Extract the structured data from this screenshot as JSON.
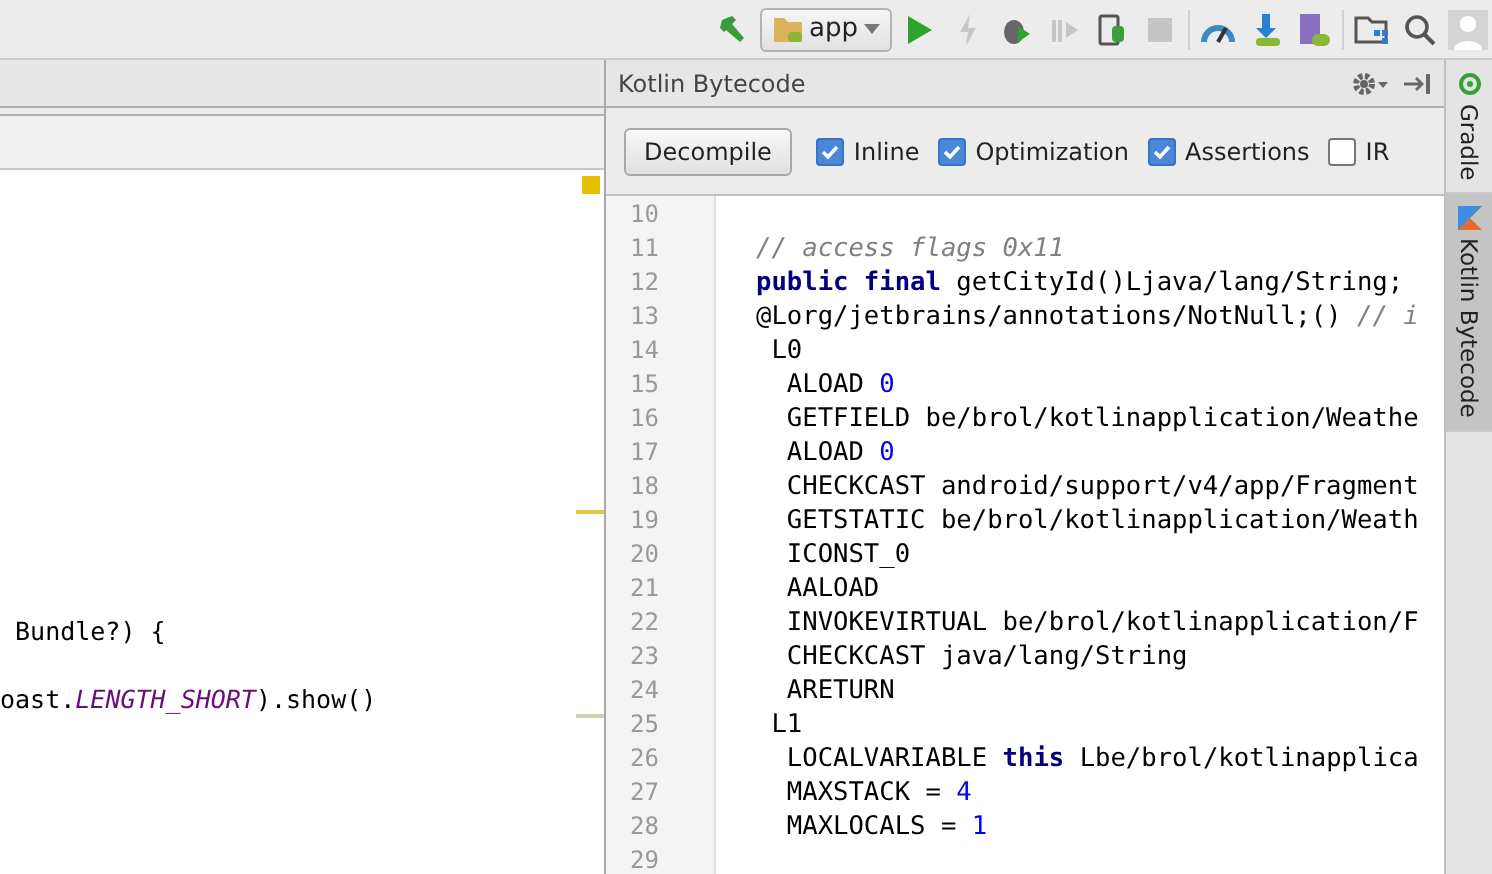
{
  "toolbar": {
    "run_config": "app",
    "buttons": [
      {
        "kind": "build",
        "disabled": false
      },
      {
        "kind": "config"
      },
      {
        "kind": "run",
        "disabled": false
      },
      {
        "kind": "apply",
        "disabled": true
      },
      {
        "kind": "debug",
        "disabled": false
      },
      {
        "kind": "attach",
        "disabled": true
      },
      {
        "kind": "device",
        "disabled": false
      },
      {
        "kind": "stop",
        "disabled": true
      },
      {
        "kind": "profiler",
        "disabled": false
      },
      {
        "kind": "sdk",
        "disabled": false
      },
      {
        "kind": "avd",
        "disabled": false
      },
      {
        "kind": "structure",
        "disabled": false
      },
      {
        "kind": "search",
        "disabled": false
      },
      {
        "kind": "avatar",
        "disabled": false
      }
    ]
  },
  "editor": {
    "lines": [
      [
        {
          "text": " Bundle?) {",
          "kind": "plain"
        }
      ],
      [
        {
          "text": "oast.",
          "kind": "plain"
        },
        {
          "text": "LENGTH_SHORT",
          "kind": "constant"
        },
        {
          "text": ").show()",
          "kind": "plain"
        }
      ]
    ]
  },
  "bytecode_panel": {
    "title": "Kotlin Bytecode",
    "decompile": "Decompile",
    "options": [
      {
        "label": "Inline",
        "checked": true
      },
      {
        "label": "Optimization",
        "checked": true
      },
      {
        "label": "Assertions",
        "checked": true
      },
      {
        "label": "IR",
        "checked": false
      }
    ],
    "lines": [
      {
        "number": "10"
      },
      {
        "number": "11",
        "segments": [
          {
            "text": "// access flags 0x11",
            "kind": "comment"
          }
        ]
      },
      {
        "number": "12",
        "segments": [
          {
            "text": "public final",
            "kind": "keyword"
          },
          {
            "text": " getCityId()Ljava/lang/String;",
            "kind": "plain"
          }
        ]
      },
      {
        "number": "13",
        "segments": [
          {
            "text": "@Lorg/jetbrains/annotations/NotNull;() ",
            "kind": "plain"
          },
          {
            "text": "// i",
            "kind": "comment"
          }
        ]
      },
      {
        "number": "14",
        "segments": [
          {
            "text": " L0",
            "kind": "plain"
          }
        ]
      },
      {
        "number": "15",
        "segments": [
          {
            "text": "  ALOAD ",
            "kind": "plain"
          },
          {
            "text": "0",
            "kind": "number"
          }
        ]
      },
      {
        "number": "16",
        "segments": [
          {
            "text": "  GETFIELD be/brol/kotlinapplication/Weathe",
            "kind": "plain"
          }
        ]
      },
      {
        "number": "17",
        "segments": [
          {
            "text": "  ALOAD ",
            "kind": "plain"
          },
          {
            "text": "0",
            "kind": "number"
          }
        ]
      },
      {
        "number": "18",
        "segments": [
          {
            "text": "  CHECKCAST android/support/v4/app/Fragment",
            "kind": "plain"
          }
        ]
      },
      {
        "number": "19",
        "segments": [
          {
            "text": "  GETSTATIC be/brol/kotlinapplication/Weath",
            "kind": "plain"
          }
        ]
      },
      {
        "number": "20",
        "segments": [
          {
            "text": "  ICONST_0",
            "kind": "plain"
          }
        ]
      },
      {
        "number": "21",
        "segments": [
          {
            "text": "  AALOAD",
            "kind": "plain"
          }
        ]
      },
      {
        "number": "22",
        "segments": [
          {
            "text": "  INVOKEVIRTUAL be/brol/kotlinapplication/F",
            "kind": "plain"
          }
        ]
      },
      {
        "number": "23",
        "segments": [
          {
            "text": "  CHECKCAST java/lang/String",
            "kind": "plain"
          }
        ]
      },
      {
        "number": "24",
        "segments": [
          {
            "text": "  ARETURN",
            "kind": "plain"
          }
        ]
      },
      {
        "number": "25",
        "segments": [
          {
            "text": " L1",
            "kind": "plain"
          }
        ]
      },
      {
        "number": "26",
        "segments": [
          {
            "text": "  LOCALVARIABLE ",
            "kind": "plain"
          },
          {
            "text": "this",
            "kind": "keyword"
          },
          {
            "text": " Lbe/brol/kotlinapplica",
            "kind": "plain"
          }
        ]
      },
      {
        "number": "27",
        "segments": [
          {
            "text": "  MAXSTACK = ",
            "kind": "plain"
          },
          {
            "text": "4",
            "kind": "number"
          }
        ]
      },
      {
        "number": "28",
        "segments": [
          {
            "text": "  MAXLOCALS = ",
            "kind": "plain"
          },
          {
            "text": "1",
            "kind": "number"
          }
        ]
      },
      {
        "number": "29"
      }
    ]
  },
  "side_tabs": [
    {
      "label": "Gradle",
      "kind": "gradle",
      "selected": false
    },
    {
      "label": "Kotlin Bytecode",
      "kind": "kotlin",
      "selected": true
    }
  ]
}
